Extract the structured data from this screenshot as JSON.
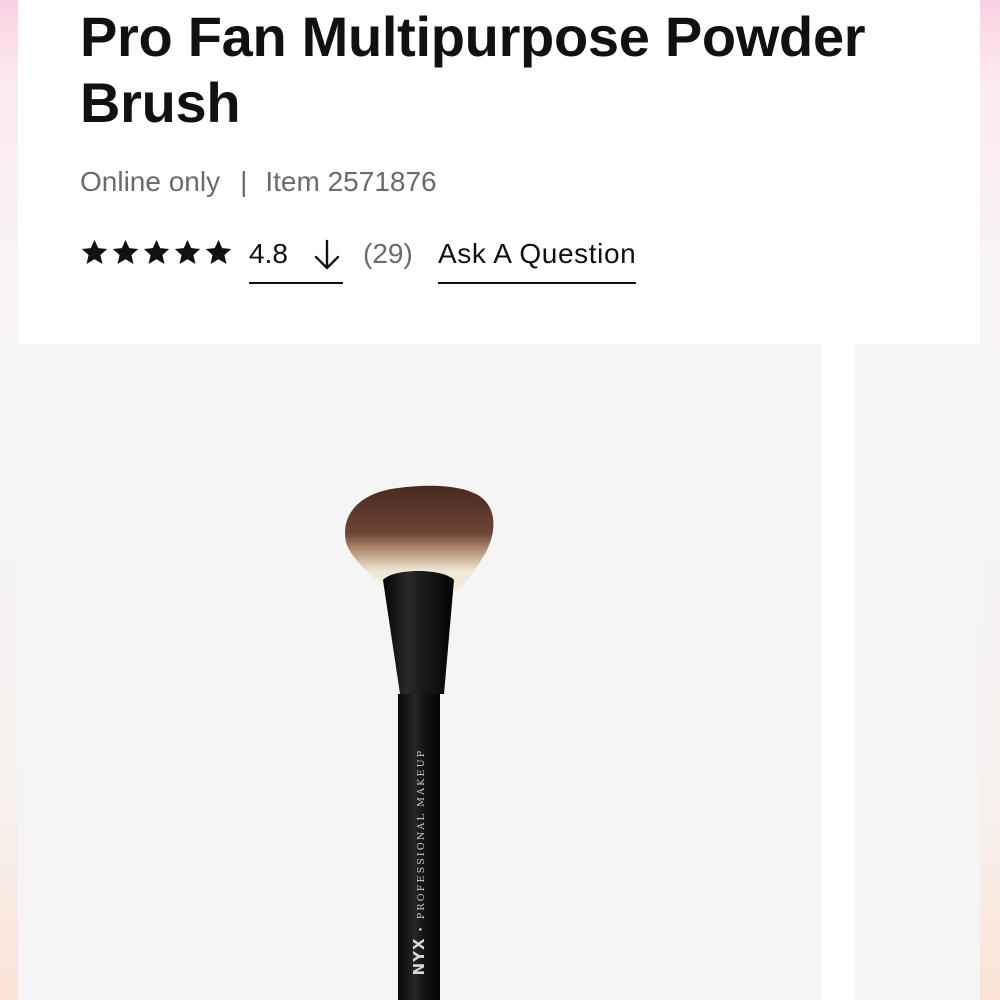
{
  "product": {
    "title": "Pro Fan Multipurpose Powder Brush",
    "availability": "Online only",
    "separator": "|",
    "item_number": "Item 2571876"
  },
  "rating": {
    "stars": 5,
    "value": "4.8",
    "sort_icon": "arrow-down-icon",
    "review_count": "(29)",
    "ask_question_label": "Ask A Question"
  },
  "gallery": {
    "brand_wordmark": "NYX",
    "brand_tagline": "PROFESSIONAL MAKEUP"
  },
  "colors": {
    "text": "#111111",
    "muted_text": "#6b6b6b",
    "image_background": "#f5f5f5",
    "brush_handle": "#0e0e0e",
    "bristle_dark": "#5a3427",
    "bristle_light": "#efe6d3"
  }
}
